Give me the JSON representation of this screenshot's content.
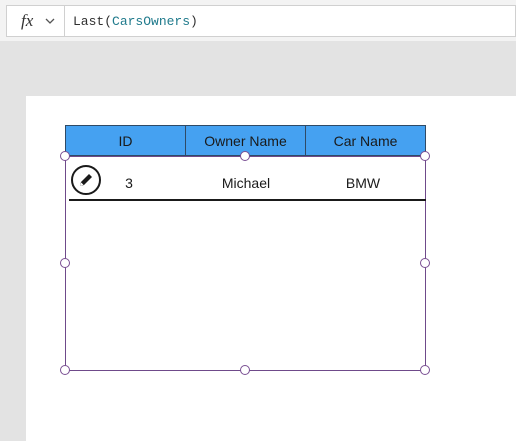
{
  "formula_bar": {
    "fx_label": "fx",
    "function_name": "Last(",
    "argument": "CarsOwners",
    "close_paren": ")"
  },
  "gallery": {
    "columns": [
      "ID",
      "Owner Name",
      "Car Name"
    ],
    "rows": [
      {
        "id": "3",
        "owner_name": "Michael",
        "car_name": "BMW",
        "action_icon": "edit-pencil-icon"
      }
    ]
  },
  "colors": {
    "header_fill": "#45a1f1",
    "selection_border": "#6f4a8a",
    "formula_identifier": "#1f7a8c"
  }
}
